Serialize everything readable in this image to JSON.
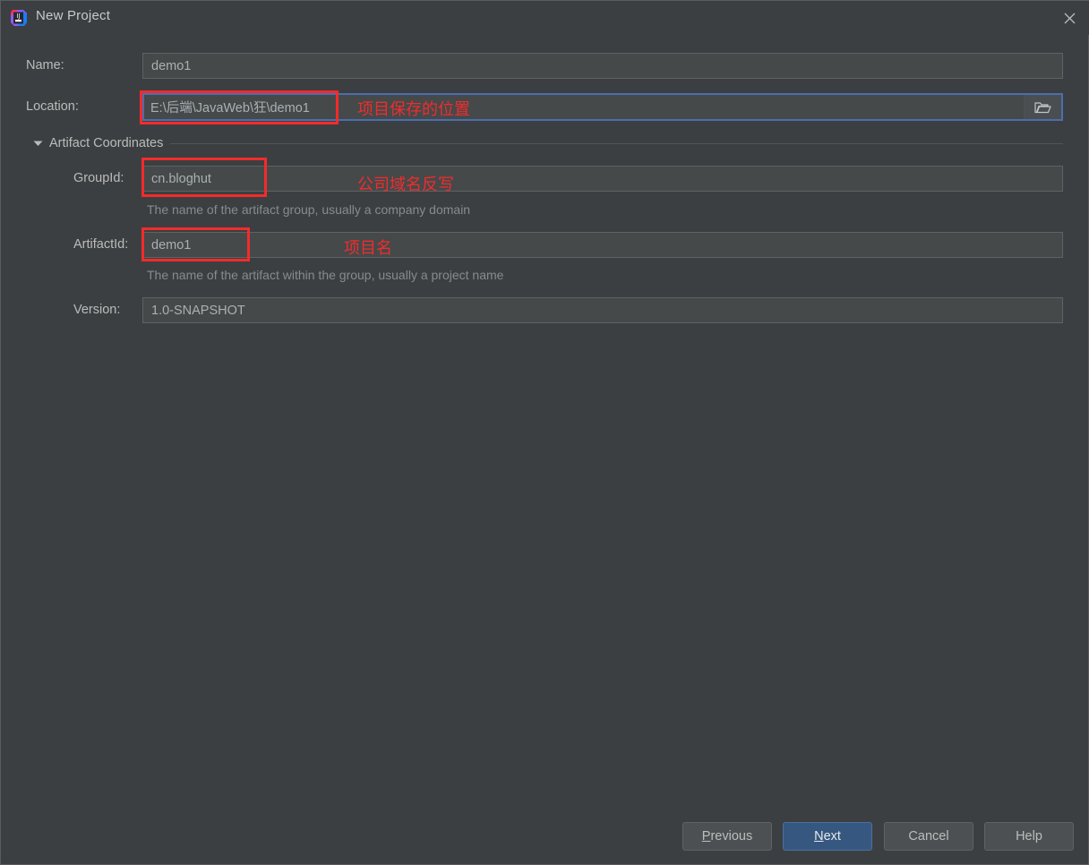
{
  "window": {
    "title": "New Project",
    "app_icon": "intellij-idea-logo",
    "close_icon": "close-icon",
    "background_color": "#3c3f41",
    "accent_color": "#4b6eaf"
  },
  "form": {
    "name": {
      "label": "Name:",
      "value": "demo1"
    },
    "location": {
      "label": "Location:",
      "value": "E:\\后端\\JavaWeb\\狂\\demo1",
      "browse_icon": "folder-icon",
      "focused": true
    },
    "coordinates_section": {
      "title": "Artifact Coordinates",
      "caret_icon": "caret-down-icon",
      "expanded": true
    },
    "group_id": {
      "label": "GroupId:",
      "value": "cn.bloghut",
      "hint": "The name of the artifact group, usually a company domain"
    },
    "artifact_id": {
      "label": "ArtifactId:",
      "value": "demo1",
      "hint": "The name of the artifact within the group, usually a project name"
    },
    "version": {
      "label": "Version:",
      "value": "1.0-SNAPSHOT"
    }
  },
  "annotations": {
    "color": "#f32b2b",
    "location_note": "项目保存的位置",
    "group_id_note": "公司域名反写",
    "artifact_id_note": "项目名"
  },
  "buttons": {
    "previous": {
      "mnemonic": "P",
      "rest": "revious"
    },
    "next": {
      "mnemonic": "N",
      "rest": "ext"
    },
    "cancel": {
      "label": "Cancel"
    },
    "help": {
      "label": "Help"
    }
  }
}
